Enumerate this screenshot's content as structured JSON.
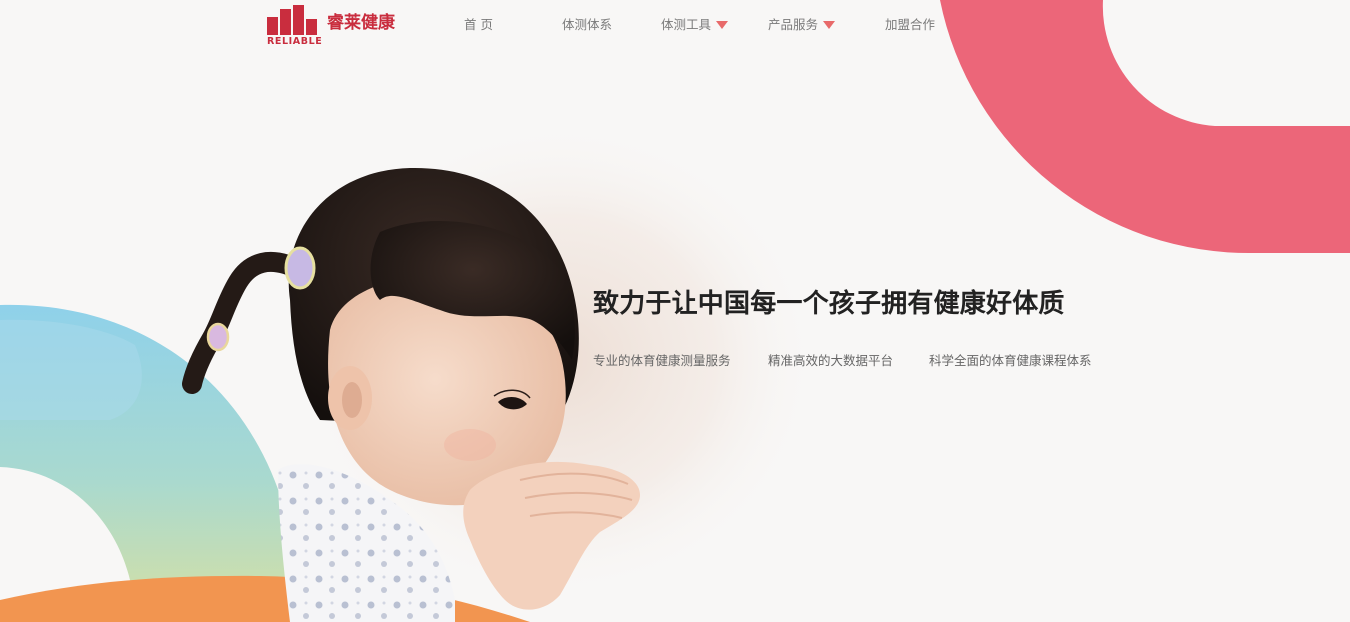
{
  "brand": {
    "name_cn": "睿莱健康",
    "name_en": "RELIABLE",
    "color": "#c92d3e"
  },
  "nav": {
    "items": [
      {
        "label": "首 页",
        "has_dropdown": false
      },
      {
        "label": "体测体系",
        "has_dropdown": false
      },
      {
        "label": "体测工具",
        "has_dropdown": true
      },
      {
        "label": "产品服务",
        "has_dropdown": true
      },
      {
        "label": "加盟合作",
        "has_dropdown": false
      }
    ],
    "dropdown_icon": "caret-down-icon",
    "dropdown_color": "#e86a6a"
  },
  "hero": {
    "tagline": "致力于让中国每一个孩子拥有健康好体质",
    "features": [
      "专业的体育健康测量服务",
      "精准高效的大数据平台",
      "科学全面的体育健康课程体系"
    ],
    "image": "child-covering-mouth-photo",
    "colors": {
      "pink_arc": "#ec6679",
      "gradient_top": "#8fd1ea",
      "gradient_bottom": "#c4dea8",
      "orange_band": "#f29550"
    }
  }
}
